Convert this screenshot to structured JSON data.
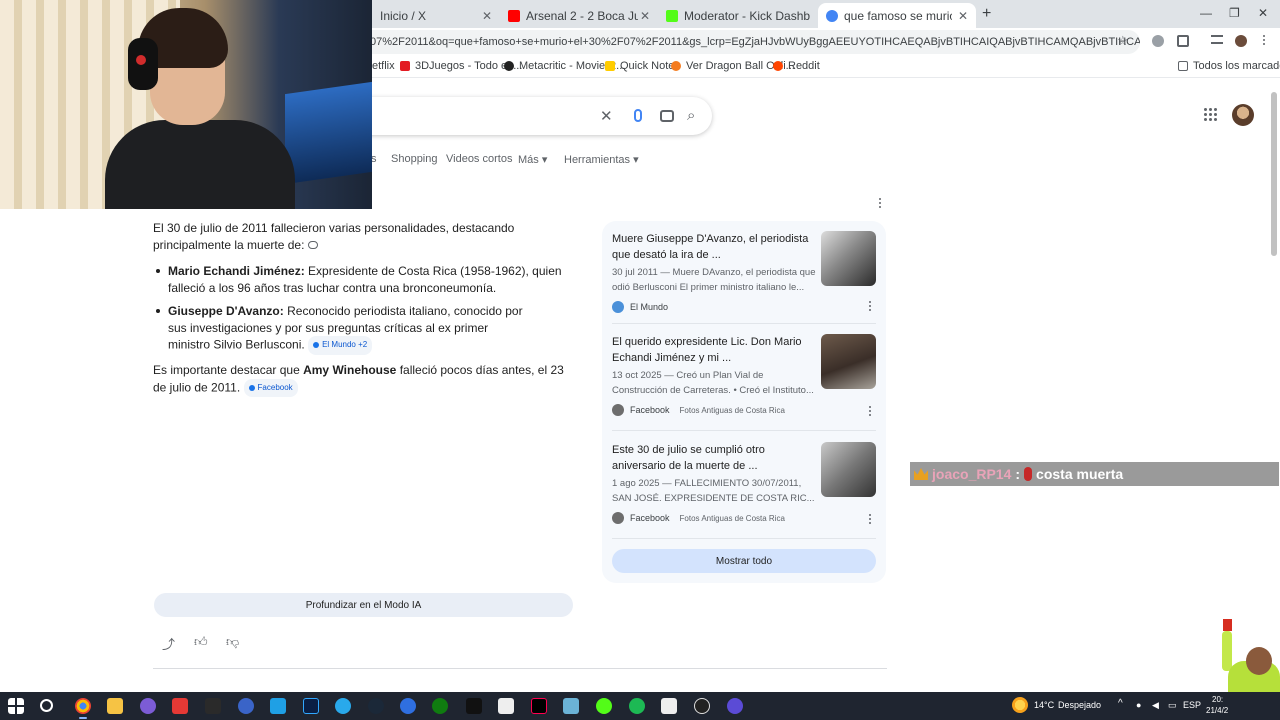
{
  "browser": {
    "tabs": [
      {
        "title": "Inicio / X",
        "color": "#000000"
      },
      {
        "title": "Arsenal 2 - 2 Boca Juniors - Em",
        "color": "#ff0000"
      },
      {
        "title": "Moderator - Kick Dashboard",
        "color": "#53fc18"
      },
      {
        "title": "que famoso se murio el 30/07/",
        "color": "#4285f4"
      }
    ],
    "url": "07%2F2011&oq=que+famoso+se+murio+el+30%2F07%2F2011&gs_lcrp=EgZjaHJvbWUyBggAEEUYOTIHCAEQABjvBTIHCAIQABjvBTIHCAMQABjvBTIHCAQQABjvBdIBCDM3NTFq...",
    "bookmarks": [
      {
        "label": "etflix",
        "color": "#e50914"
      },
      {
        "label": "3DJuegos - Todo en...",
        "color": "#e31b23"
      },
      {
        "label": "Metacritic - Movie R...",
        "color": "#222222"
      },
      {
        "label": "Quick Note",
        "color": "#ffcc00"
      },
      {
        "label": "Ver Dragon Ball Onli...",
        "color": "#f47c20"
      },
      {
        "label": "Reddit",
        "color": "#ff4500"
      }
    ],
    "all_bookmarks": "Todos los marcadores"
  },
  "search": {
    "tabs": [
      "s",
      "Shopping",
      "Videos cortos",
      "Más",
      "Herramientas"
    ]
  },
  "overview": {
    "intro": "El 30 de julio de 2011 fallecieron varias personalidades, destacando principalmente la muerte de:",
    "items": [
      {
        "name": "Mario Echandi Jiménez:",
        "text": "Expresidente de Costa Rica (1958-1962), quien falleció a los 96 años tras luchar contra una bronconeumonía."
      },
      {
        "name": "Giuseppe D'Avanzo:",
        "text": "Reconocido periodista italiano, conocido por sus investigaciones y por sus preguntas críticas al ex primer ministro Silvio Berlusconi.",
        "chip": "El Mundo +2"
      }
    ],
    "note_prefix": "Es importante destacar que",
    "note_name": "Amy Winehouse",
    "note_suffix": "falleció pocos días antes, el 23 de julio de 2011.",
    "note_chip": "Facebook",
    "deeper_button": "Profundizar en el Modo IA"
  },
  "sources": {
    "cards": [
      {
        "title": "Muere Giuseppe D'Avanzo, el periodista que desató la ira de ...",
        "snippet": "30 jul 2011 — Muere DAvanzo, el periodista que odió Berlusconi El primer ministro italiano le...",
        "source": "El Mundo",
        "subsource": ""
      },
      {
        "title": "El querido expresidente Lic. Don Mario Echandi Jiménez y mi ...",
        "snippet": "13 oct 2025 — Creó un Plan Vial de Construcción de Carreteras. • Creó el Instituto...",
        "source": "Facebook",
        "subsource": "Fotos Antiguas de Costa Rica"
      },
      {
        "title": "Este 30 de julio se cumplió otro aniversario de la muerte de ...",
        "snippet": "1 ago 2025 — FALLECIMIENTO 30/07/2011, SAN JOSÉ. EXPRESIDENTE DE COSTA RIC...",
        "source": "Facebook",
        "subsource": "Fotos Antiguas de Costa Rica"
      }
    ],
    "show_all": "Mostrar todo"
  },
  "chat": {
    "user": "joaco_RP14",
    "colon": ":",
    "message": "costa muerta",
    "user_color": "#e9a3b8"
  },
  "taskbar": {
    "weather_temp": "14°C",
    "weather_text": "Despejado",
    "lang": "ESP",
    "time": "20:",
    "date": "21/4/2"
  }
}
